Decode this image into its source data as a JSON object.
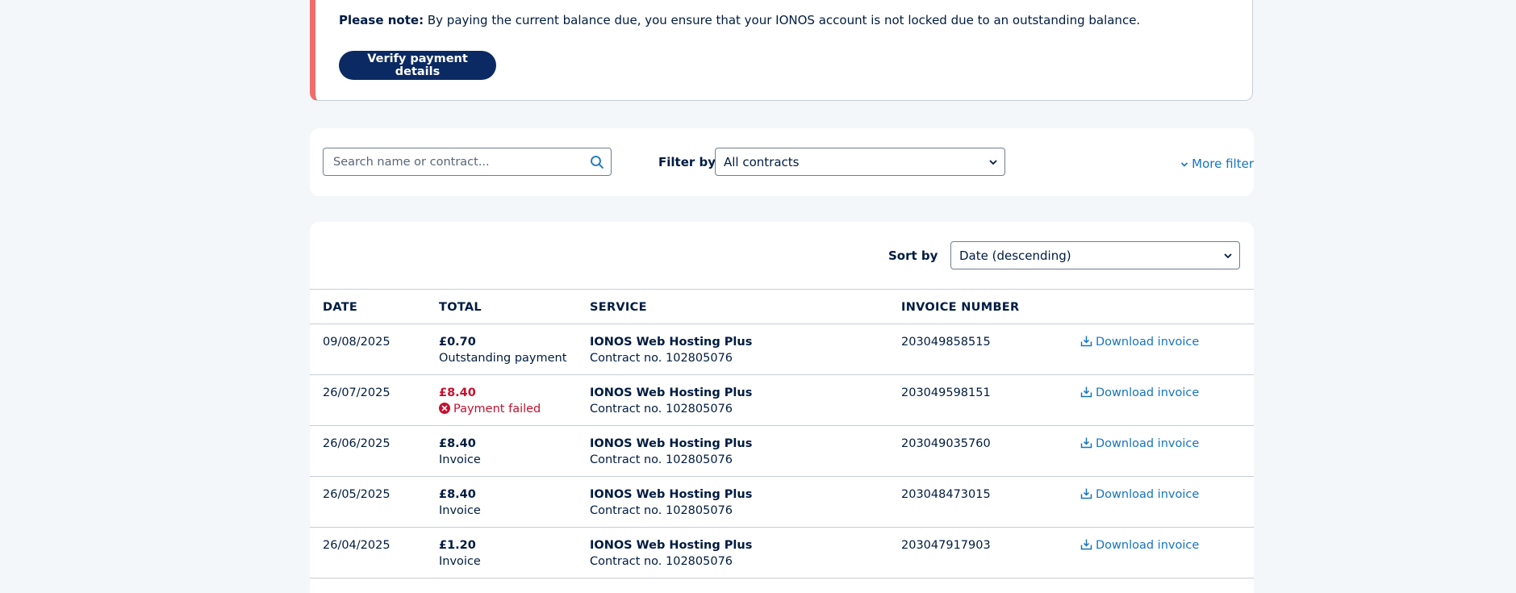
{
  "alert": {
    "note_label": "Please note:",
    "note_text": " By paying the current balance due, you ensure that your IONOS account is not locked due to an outstanding balance.",
    "verify_button": "Verify payment details"
  },
  "filters": {
    "search_placeholder": "Search name or contract...",
    "filter_by_label": "Filter by",
    "contract_selected": "All contracts",
    "more_filter": "More filter"
  },
  "table": {
    "sort_by_label": "Sort by",
    "sort_selected": "Date (descending)",
    "headers": {
      "date": "DATE",
      "total": "TOTAL",
      "service": "SERVICE",
      "invoice_number": "INVOICE NUMBER"
    },
    "rows": [
      {
        "date": "09/08/2025",
        "amount": "£0.70",
        "status": "Outstanding payment",
        "failed": false,
        "service": "IONOS Web Hosting Plus",
        "contract": "Contract no. 102805076",
        "invoice": "203049858515",
        "action": "Download invoice"
      },
      {
        "date": "26/07/2025",
        "amount": "£8.40",
        "status": "Payment failed",
        "failed": true,
        "service": "IONOS Web Hosting Plus",
        "contract": "Contract no. 102805076",
        "invoice": "203049598151",
        "action": "Download invoice"
      },
      {
        "date": "26/06/2025",
        "amount": "£8.40",
        "status": "Invoice",
        "failed": false,
        "service": "IONOS Web Hosting Plus",
        "contract": "Contract no. 102805076",
        "invoice": "203049035760",
        "action": "Download invoice"
      },
      {
        "date": "26/05/2025",
        "amount": "£8.40",
        "status": "Invoice",
        "failed": false,
        "service": "IONOS Web Hosting Plus",
        "contract": "Contract no. 102805076",
        "invoice": "203048473015",
        "action": "Download invoice"
      },
      {
        "date": "26/04/2025",
        "amount": "£1.20",
        "status": "Invoice",
        "failed": false,
        "service": "IONOS Web Hosting Plus",
        "contract": "Contract no. 102805076",
        "invoice": "203047917903",
        "action": "Download invoice"
      }
    ]
  },
  "colors": {
    "alert_stripe": "#f06e6a",
    "primary_button": "#0b2a63",
    "link": "#1474c4",
    "error": "#c8102e"
  }
}
